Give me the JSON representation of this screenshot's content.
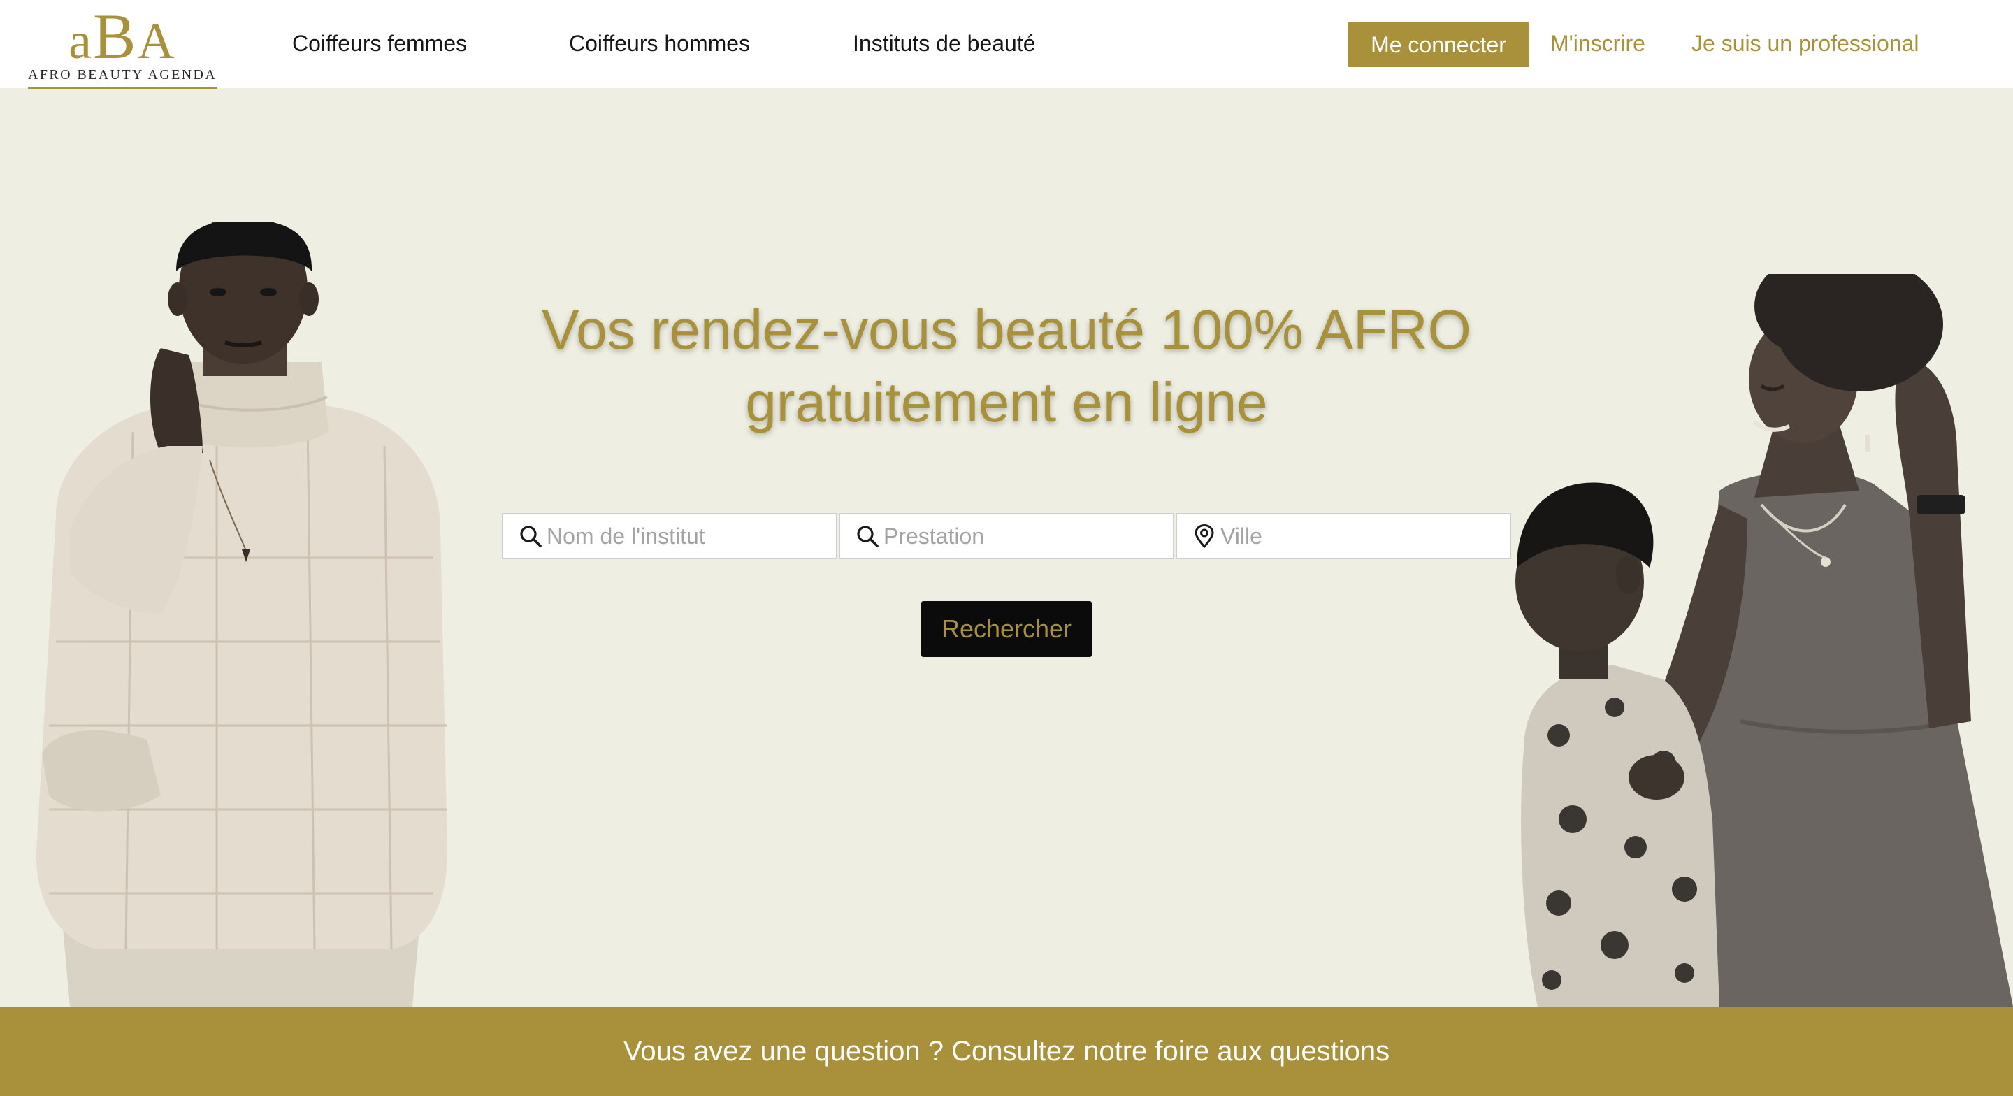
{
  "brand": {
    "mark_prefix": "a",
    "mark_big": "B",
    "mark_suffix": "A",
    "tagline": "AFRO BEAUTY AGENDA",
    "accent_color": "#a8913a"
  },
  "nav": {
    "links": [
      {
        "label": "Coiffeurs femmes"
      },
      {
        "label": "Coiffeurs hommes"
      },
      {
        "label": "Instituts de beauté"
      }
    ],
    "login_label": "Me connecter",
    "signup_label": "M'inscrire",
    "pro_label": "Je suis un professional"
  },
  "hero": {
    "title_line1": "Vos rendez-vous beauté 100% AFRO",
    "title_line2": "gratuitement en ligne"
  },
  "search": {
    "fields": [
      {
        "placeholder": "Nom de l'institut",
        "icon": "search-icon"
      },
      {
        "placeholder": "Prestation",
        "icon": "search-icon"
      },
      {
        "placeholder": "Ville",
        "icon": "location-pin-icon"
      }
    ],
    "button_label": "Rechercher"
  },
  "footer": {
    "faq_text": "Vous avez une question ? Consultez notre foire aux questions"
  }
}
